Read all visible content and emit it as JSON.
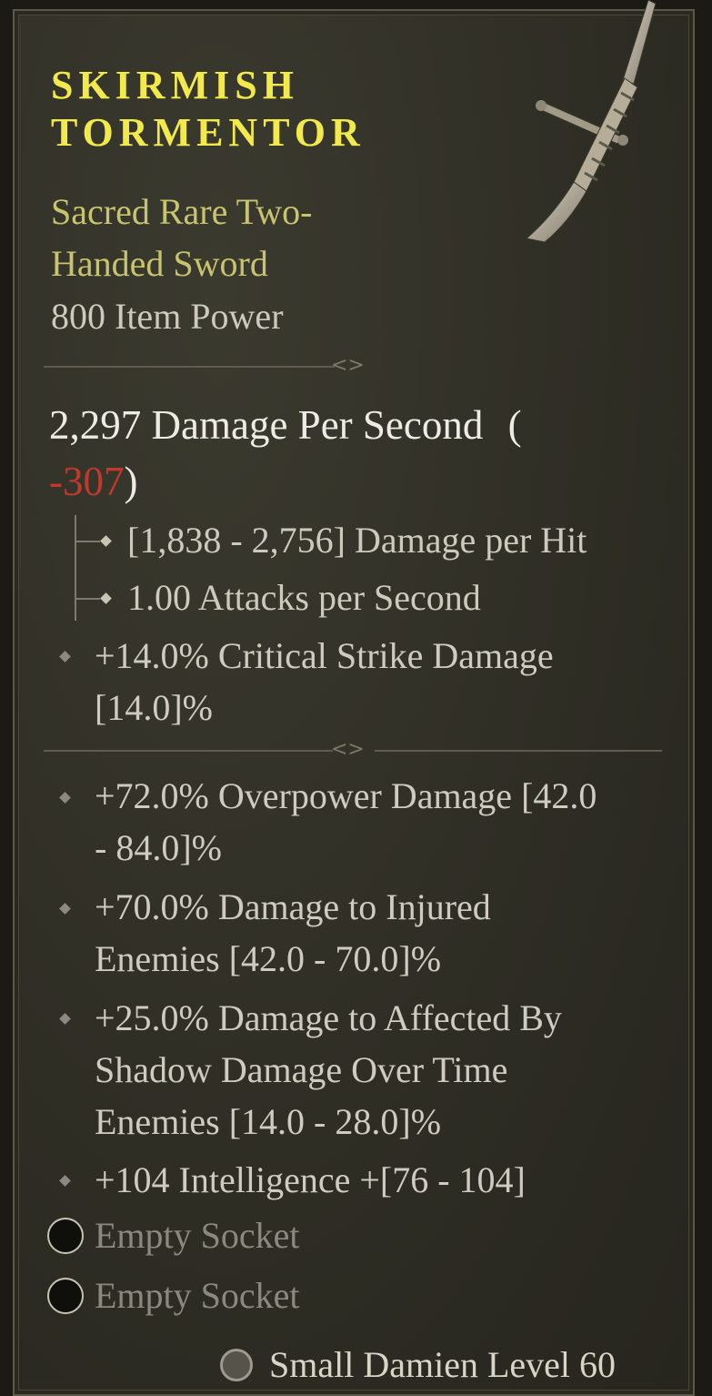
{
  "item": {
    "name_line1": "SKIRMISH",
    "name_line2": "TORMENTOR",
    "type": "Sacred Rare Two-Handed Sword",
    "item_power": "800 Item Power",
    "item_icon": "two-handed-sword-icon"
  },
  "dps": {
    "value_text": "2,297 Damage Per Second",
    "open_paren": "(",
    "delta": "-307",
    "close_paren": ")"
  },
  "base_stats": [
    {
      "text": "[1,838 - 2,756] Damage per Hit"
    },
    {
      "text": "1.00 Attacks per Second"
    }
  ],
  "implicit": {
    "text": "+14.0% Critical Strike Damage [14.0]%"
  },
  "affixes": [
    {
      "text": "+72.0% Overpower Damage [42.0 - 84.0]%"
    },
    {
      "text": "+70.0% Damage to Injured Enemies [42.0 - 70.0]%"
    },
    {
      "text": "+25.0% Damage to Affected By Shadow Damage Over Time Enemies [14.0 - 28.0]%"
    },
    {
      "text": "+104 Intelligence +[76 - 104]"
    }
  ],
  "sockets": [
    {
      "label": "Empty Socket"
    },
    {
      "label": "Empty Socket"
    }
  ],
  "footer": {
    "text": "Small Damien Level 60"
  },
  "colors": {
    "rare_title": "#f2e94b",
    "rare_type": "#c8c36f",
    "negative": "#c0392b",
    "text": "#cfcbc0"
  }
}
